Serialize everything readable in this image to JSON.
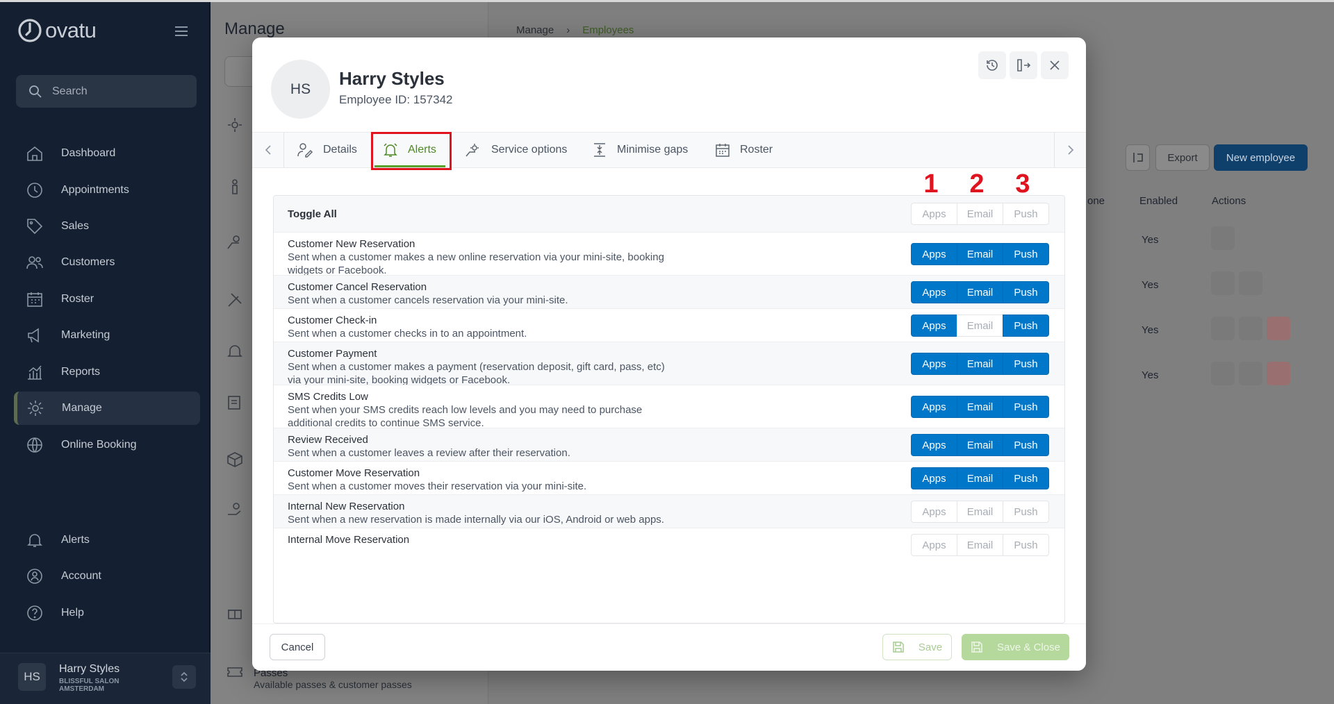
{
  "app": {
    "name": "ovatu"
  },
  "sidebar": {
    "search_placeholder": "Search",
    "items": [
      {
        "label": "Dashboard",
        "icon": "home-icon"
      },
      {
        "label": "Appointments",
        "icon": "clock-icon"
      },
      {
        "label": "Sales",
        "icon": "tag-icon"
      },
      {
        "label": "Customers",
        "icon": "users-icon"
      },
      {
        "label": "Roster",
        "icon": "calendar-icon"
      },
      {
        "label": "Marketing",
        "icon": "megaphone-icon"
      },
      {
        "label": "Reports",
        "icon": "chart-icon"
      },
      {
        "label": "Manage",
        "icon": "gear-icon",
        "active": true
      },
      {
        "label": "Online Booking",
        "icon": "globe-icon"
      }
    ],
    "bottom_items": [
      {
        "label": "Alerts",
        "icon": "bell-icon"
      },
      {
        "label": "Account",
        "icon": "account-icon"
      },
      {
        "label": "Help",
        "icon": "help-icon"
      }
    ],
    "user": {
      "initials": "HS",
      "name": "Harry Styles",
      "org_line1": "BLISSFUL SALON",
      "org_line2": "AMSTERDAM"
    }
  },
  "background": {
    "title": "Manage",
    "breadcrumb": [
      "Manage",
      "Employees"
    ],
    "passes_title": "Passes",
    "passes_sub": "Available passes & customer passes",
    "export": "Export",
    "new_employee": "New employee",
    "col_phone": "one",
    "col_enabled": "Enabled",
    "col_actions": "Actions",
    "rows": [
      "Yes",
      "Yes",
      "Yes",
      "Yes"
    ]
  },
  "modal": {
    "initials": "HS",
    "name": "Harry Styles",
    "employee_id": "Employee ID: 157342",
    "tabs": [
      "Details",
      "Alerts",
      "Service options",
      "Minimise gaps",
      "Roster"
    ],
    "annotations": [
      "1",
      "2",
      "3"
    ],
    "toggle_all": "Toggle All",
    "channel_labels": [
      "Apps",
      "Email",
      "Push"
    ],
    "rows": [
      {
        "title": "Customer New Reservation",
        "desc1": "Sent when a customer makes a new online reservation via your mini-site, booking",
        "desc2": "widgets or Facebook.",
        "apps": true,
        "email": true,
        "push": true
      },
      {
        "title": "Customer Cancel Reservation",
        "desc1": "Sent when a customer cancels reservation via your mini-site.",
        "desc2": "",
        "apps": true,
        "email": true,
        "push": true
      },
      {
        "title": "Customer Check-in",
        "desc1": "Sent when a customer checks in to an appointment.",
        "desc2": "",
        "apps": true,
        "email": false,
        "push": true
      },
      {
        "title": "Customer Payment",
        "desc1": "Sent when a customer makes a payment (reservation deposit, gift card, pass, etc)",
        "desc2": "via your mini-site, booking widgets or Facebook.",
        "apps": true,
        "email": true,
        "push": true
      },
      {
        "title": "SMS Credits Low",
        "desc1": "Sent when your SMS credits reach low levels and you may need to purchase",
        "desc2": "additional credits to continue SMS service.",
        "apps": true,
        "email": true,
        "push": true
      },
      {
        "title": "Review Received",
        "desc1": "Sent when a customer leaves a review after their reservation.",
        "desc2": "",
        "apps": true,
        "email": true,
        "push": true
      },
      {
        "title": "Customer Move Reservation",
        "desc1": "Sent when a customer moves their reservation via your mini-site.",
        "desc2": "",
        "apps": true,
        "email": true,
        "push": true
      },
      {
        "title": "Internal New Reservation",
        "desc1": "Sent when a new reservation is made internally via our iOS, Android or web apps.",
        "desc2": "",
        "apps": false,
        "email": false,
        "push": false
      },
      {
        "title": "Internal Move Reservation",
        "desc1": "",
        "desc2": "",
        "apps": false,
        "email": false,
        "push": false
      }
    ],
    "cancel": "Cancel",
    "save": "Save",
    "save_close": "Save & Close"
  }
}
